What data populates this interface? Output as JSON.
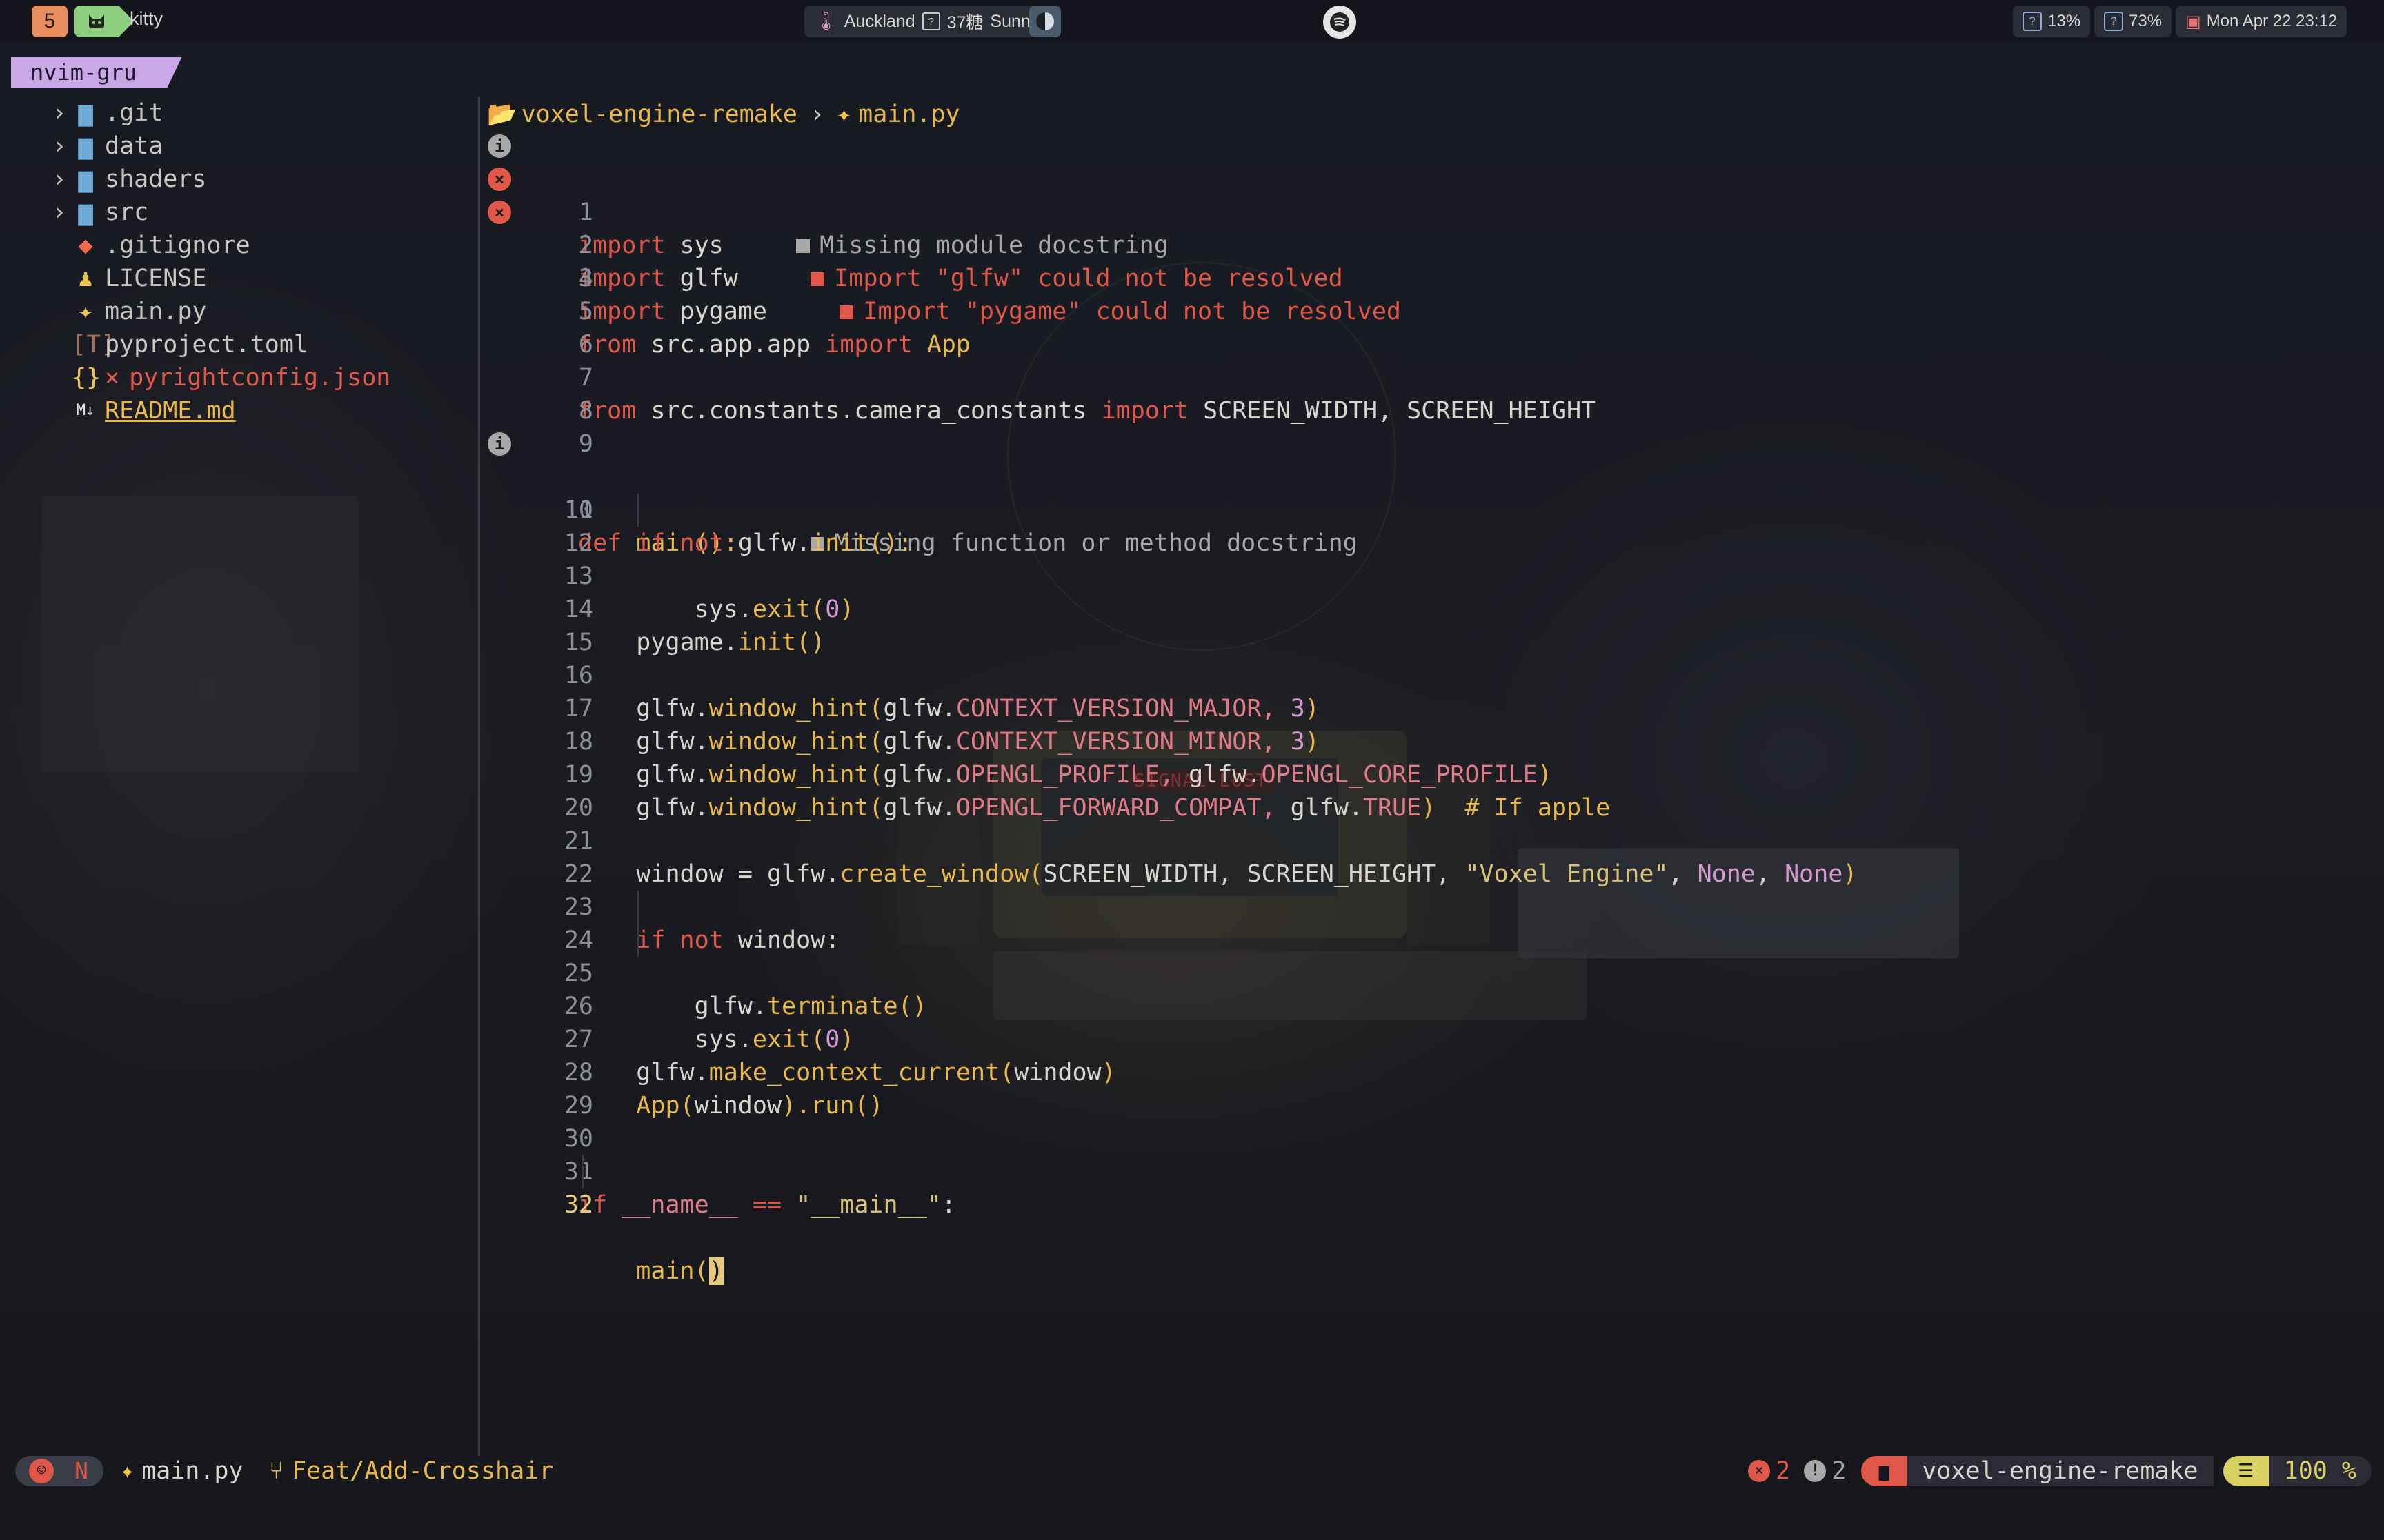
{
  "topbar": {
    "workspace_number": "5",
    "workspace_icon": "cat-icon",
    "window_title": "kitty",
    "weather": {
      "location": "Auckland",
      "temp": "37糖",
      "condition": "Sunny"
    },
    "cpu": "13%",
    "memory": "73%",
    "datetime": "Mon Apr 22 23:12"
  },
  "background_text": {
    "signal": "SIGNAL LOST"
  },
  "tab": {
    "label": "nvim-gru"
  },
  "tree": {
    "items": [
      {
        "name": ".git",
        "type": "folder"
      },
      {
        "name": "data",
        "type": "folder"
      },
      {
        "name": "shaders",
        "type": "folder"
      },
      {
        "name": "src",
        "type": "folder"
      },
      {
        "name": ".gitignore",
        "type": "file",
        "icon": "git-icon"
      },
      {
        "name": "LICENSE",
        "type": "file",
        "icon": "license-icon"
      },
      {
        "name": "main.py",
        "type": "file",
        "icon": "python-icon"
      },
      {
        "name": "pyproject.toml",
        "type": "file",
        "icon": "toml-icon"
      },
      {
        "name": "pyrightconfig.json",
        "type": "file",
        "icon": "json-icon",
        "mark": "×"
      },
      {
        "name": "README.md",
        "type": "file",
        "icon": "markdown-icon"
      }
    ]
  },
  "breadcrumb": {
    "folder": "voxel-engine-remake",
    "separator": "›",
    "file": "main.py"
  },
  "editor": {
    "line_numbers": [
      "1",
      "2",
      "3",
      "4",
      "5",
      "6",
      "7",
      "8",
      "9",
      "10",
      "11",
      "12",
      "13",
      "14",
      "15",
      "16",
      "17",
      "18",
      "19",
      "20",
      "21",
      "22",
      "23",
      "24",
      "25",
      "26",
      "27",
      "28",
      "29",
      "30",
      "31",
      "32"
    ],
    "diagnostics": {
      "d1": "Missing module docstring",
      "d2": "Import \"glfw\" could not be resolved",
      "d3": "Import \"pygame\" could not be resolved",
      "d10": "Missing function or method docstring"
    },
    "tokens": {
      "import": "import",
      "from": "from",
      "def": "def",
      "if": "if",
      "not": "not",
      "sys": "sys",
      "glfw": "glfw",
      "pygame": "pygame",
      "src_app_app": "src.app.app",
      "App": "App",
      "src_constants": "src.constants.camera_constants",
      "SCREEN_WIDTH": "SCREEN_WIDTH",
      "SCREEN_HEIGHT": "SCREEN_HEIGHT",
      "main": "main",
      "init": "init",
      "exit": "exit",
      "window_hint": "window_hint",
      "CONTEXT_VERSION_MAJOR": "CONTEXT_VERSION_MAJOR",
      "CONTEXT_VERSION_MINOR": "CONTEXT_VERSION_MINOR",
      "OPENGL_PROFILE": "OPENGL_PROFILE",
      "OPENGL_CORE_PROFILE": "OPENGL_CORE_PROFILE",
      "OPENGL_FORWARD_COMPAT": "OPENGL_FORWARD_COMPAT",
      "TRUE": "TRUE",
      "comment_apple": "# If apple",
      "window": "window",
      "create_window": "create_window",
      "title_str": "\"Voxel Engine\"",
      "None": "None",
      "terminate": "terminate",
      "make_context_current": "make_context_current",
      "run": "run",
      "dunder_name": "__name__",
      "eq": "==",
      "dunder_main_str": "\"__main__\"",
      "zero": "0",
      "three": "3"
    }
  },
  "statusline": {
    "mode": "N",
    "file": "main.py",
    "branch": "Feat/Add-Crosshair",
    "errors": "2",
    "warnings": "2",
    "project": "voxel-engine-remake",
    "progress": "100 %"
  }
}
